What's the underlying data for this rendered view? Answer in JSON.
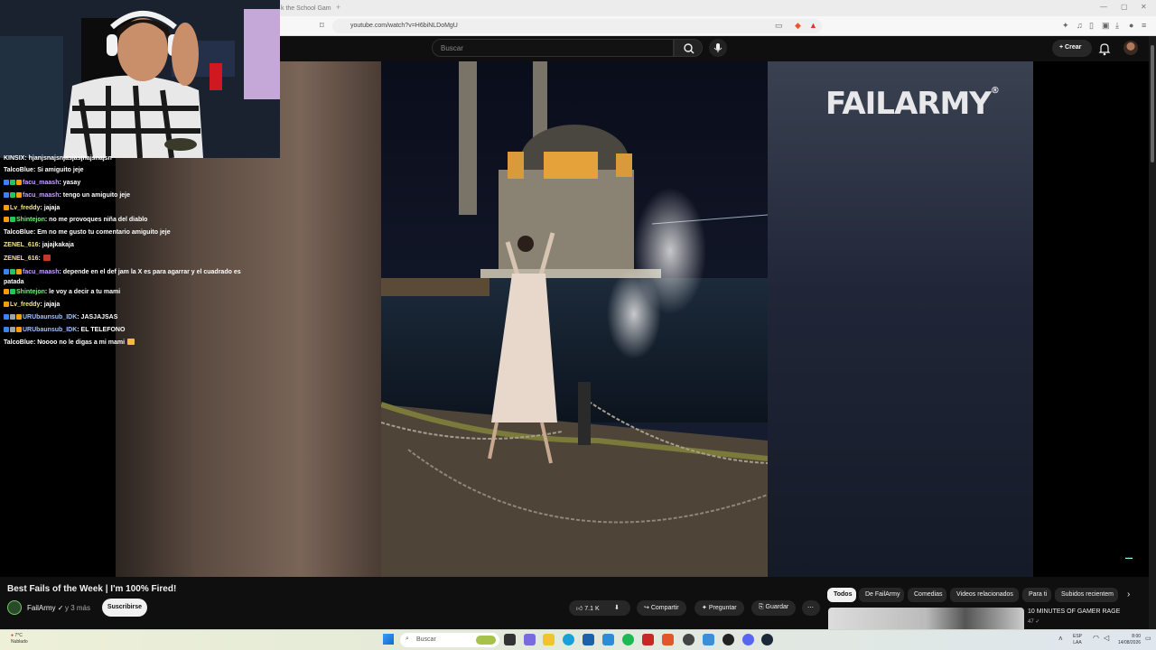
{
  "browser": {
    "tab_title": "k the School Gam",
    "url": "youtube.com/watch?v=H6biNLDoMgU"
  },
  "header": {
    "search_placeholder": "Buscar",
    "create_label": "Crear"
  },
  "player": {
    "brand_watermark": "FAILARMY",
    "brand_mark": "®"
  },
  "chat": [
    {
      "user": "KINSIX",
      "text": ": hjanjsnajsnjasjasjnajsnajsn",
      "color": "#ffffff",
      "badges": []
    },
    {
      "user": "TalcoBlue",
      "text": ": Si amiguito jeje",
      "color": "#ffffff",
      "badges": []
    },
    {
      "user": "facu_maash",
      "text": ": yasay",
      "color": "#c9a0ff",
      "badges": [
        "#3b82f6",
        "#22c55e",
        "#f59e0b"
      ]
    },
    {
      "user": "facu_maash",
      "text": ": tengo un amiguito jeje",
      "color": "#c9a0ff",
      "badges": [
        "#3b82f6",
        "#22c55e",
        "#f59e0b"
      ]
    },
    {
      "user": "Lv_freddy",
      "text": ": jajaja",
      "color": "#f5e58a",
      "badges": [
        "#f59e0b"
      ]
    },
    {
      "user": "Shintejon",
      "text": ": no me provoques niña del diablo",
      "color": "#7cf07c",
      "badges": [
        "#f59e0b",
        "#22c55e"
      ]
    },
    {
      "user": "TalcoBlue",
      "text": ": Em no me gusto tu comentario amiguito jeje",
      "color": "#ffffff",
      "badges": []
    },
    {
      "user": "ZENEL_616",
      "text": ": jajajkakaja",
      "color": "#f5e58a",
      "badges": []
    },
    {
      "user": "ZENEL_616",
      "text": ":",
      "color": "#f5e58a",
      "badges": [],
      "emote": "#c0392b"
    },
    {
      "user": "facu_maash",
      "text": ": depende en el def jam la X es para agarrar y el cuadrado es patada",
      "color": "#c9a0ff",
      "badges": [
        "#3b82f6",
        "#22c55e",
        "#f59e0b"
      ],
      "wrap": true
    },
    {
      "user": "Shintejon",
      "text": ": le voy a decir a tu mami",
      "color": "#7cf07c",
      "badges": [
        "#f59e0b",
        "#22c55e"
      ]
    },
    {
      "user": "Lv_freddy",
      "text": ": jajaja",
      "color": "#f5e58a",
      "badges": [
        "#f59e0b"
      ]
    },
    {
      "user": "URUbaunsub_IDK",
      "text": ": JASJAJSAS",
      "color": "#9ec5ff",
      "badges": [
        "#3b82f6",
        "#9ca3af",
        "#f59e0b"
      ]
    },
    {
      "user": "URUbaunsub_IDK",
      "text": ": EL TELEFONO",
      "color": "#9ec5ff",
      "badges": [
        "#3b82f6",
        "#9ca3af",
        "#f59e0b"
      ]
    },
    {
      "user": "TalcoBlue",
      "text": ": Noooo no le digas a mi mami",
      "color": "#ffffff",
      "badges": [],
      "emote": "#f5b942"
    }
  ],
  "video": {
    "title": "Best Fails of the Week | I'm 100% Fired!",
    "channel": "FailArmy",
    "age": "y 3 más",
    "subscribe_label": "Suscribirse",
    "likes": "7.1 K",
    "share_label": "Compartir",
    "ask_label": "Preguntar",
    "save_label": "Guardar"
  },
  "chips": [
    "Todos",
    "De FailArmy",
    "Comedias",
    "Videos relacionados",
    "Para ti",
    "Subidos recientem"
  ],
  "recommended": {
    "title": "10 MINUTES OF GAMER RAGE",
    "meta": "47"
  },
  "taskbar": {
    "weather_temp": "7°C",
    "weather_desc": "Nublado",
    "search_label": "Buscar",
    "lang_top": "ESP",
    "lang_bottom": "LAA",
    "time": "8:00",
    "date": "14/08/2026"
  }
}
